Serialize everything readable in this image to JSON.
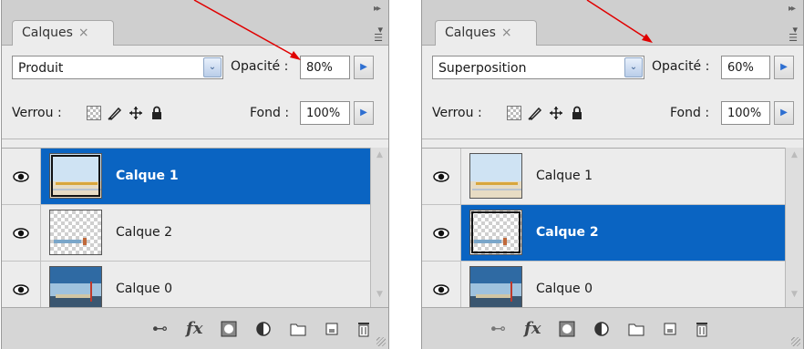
{
  "panels": [
    {
      "tab_label": "Calques",
      "blend_mode": "Produit",
      "opacity_label": "Opacité :",
      "opacity_value": "80%",
      "lock_label": "Verrou :",
      "fill_label": "Fond :",
      "fill_value": "100%",
      "layers": [
        {
          "name": "Calque 1",
          "selected": true
        },
        {
          "name": "Calque 2",
          "selected": false
        },
        {
          "name": "Calque 0",
          "selected": false
        }
      ]
    },
    {
      "tab_label": "Calques",
      "blend_mode": "Superposition",
      "opacity_label": "Opacité :",
      "opacity_value": "60%",
      "lock_label": "Verrou :",
      "fill_label": "Fond :",
      "fill_value": "100%",
      "layers": [
        {
          "name": "Calque 1",
          "selected": false
        },
        {
          "name": "Calque 2",
          "selected": true
        },
        {
          "name": "Calque 0",
          "selected": false
        }
      ]
    }
  ],
  "glyphs": {
    "close": "×",
    "dropdown": "⌄",
    "arrow_right": "▶",
    "expand": "▸▸",
    "scroll_up": "▲",
    "scroll_down": "▼",
    "link": "⊷",
    "fx": "fx",
    "trash": "🗑"
  },
  "colors": {
    "selection": "#0a64c2",
    "annotation_arrow": "#e00000",
    "panel_bg": "#d6d6d6",
    "list_bg": "#ececec"
  }
}
